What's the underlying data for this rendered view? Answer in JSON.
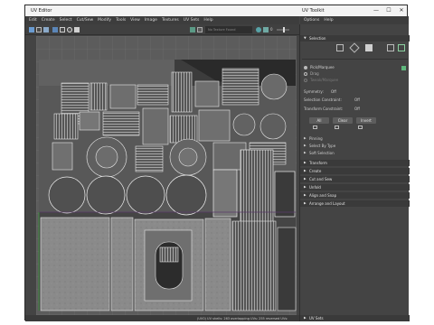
{
  "window": {
    "title": "UV Editor",
    "toolkit_title": "UV Toolkit",
    "min": "—",
    "max": "☐",
    "close": "✕"
  },
  "menu": [
    "Edit",
    "Create",
    "Select",
    "Cut/Sew",
    "Modify",
    "Tools",
    "View",
    "Image",
    "Textures",
    "UV Sets",
    "Help"
  ],
  "toolkit_menu": [
    "Options",
    "Help"
  ],
  "toolbar": {
    "texture_field": "No Texture Found",
    "value": "0"
  },
  "panel": {
    "selection_label": "Selection",
    "pick_marquee": "Pick/Marquee",
    "drag": "Drag",
    "tweak_marquee": "Tweak/Marquee",
    "symmetry_label": "Symmetry:",
    "symmetry_value": "Off",
    "selection_constraint_label": "Selection Constraint:",
    "selection_constraint_value": "Off",
    "transform_constraint_label": "Transform Constraint:",
    "transform_constraint_value": "Off",
    "all": "All",
    "clear": "Clear",
    "invert": "Invert",
    "sections": [
      "Pinning",
      "Select By Type",
      "Soft Selection",
      "Transform",
      "Create",
      "Cut and Sew",
      "Unfold",
      "Align and Snap",
      "Arrange and Layout"
    ],
    "uv_sets": "UV Sets"
  },
  "status": {
    "text": "(UV0) UV shells: 263 overlapping UVs: 255 reversed UVs:"
  }
}
